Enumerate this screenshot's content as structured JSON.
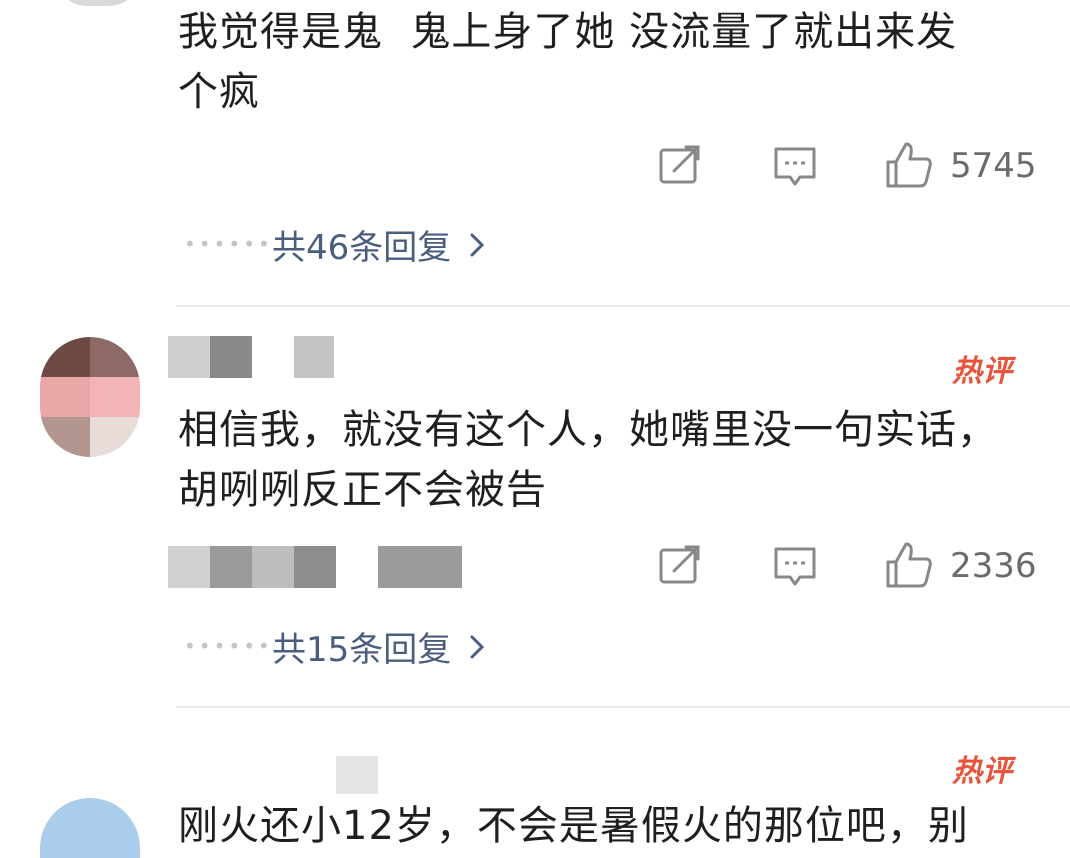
{
  "comments": [
    {
      "text": "我觉得是鬼  鬼上身了她 没流量了就出来发\n个疯",
      "likes": "5745",
      "replies_label": "共46条回复"
    },
    {
      "hot_badge": "热评",
      "text": "相信我，就没有这个人，她嘴里没一句实话，\n胡咧咧反正不会被告",
      "likes": "2336",
      "replies_label": "共15条回复"
    },
    {
      "hot_badge": "热评",
      "text": "刚火还小12岁，不会是暑假火的那位吧，别"
    }
  ],
  "icons": {
    "share": "share-icon",
    "comment": "comment-icon",
    "like": "thumbs-up-icon",
    "chevron": "chevron-right-icon"
  },
  "colors": {
    "hot_badge": "#e8553d",
    "reply_link": "#4a5d7e",
    "icon": "#888888"
  }
}
